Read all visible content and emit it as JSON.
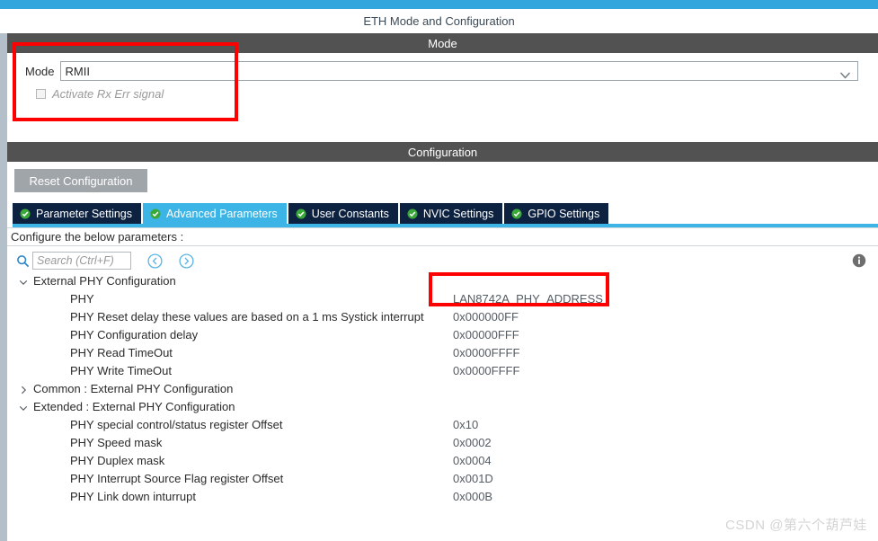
{
  "window": {
    "title": "ETH Mode and Configuration"
  },
  "colors": {
    "accent_top": "#33a6dd",
    "section_header_bg": "#525252",
    "tab_inactive_bg": "#0d2240",
    "tab_active_bg": "#3cb4e5",
    "highlight_box": "#fe0000",
    "reset_button_bg": "#a0a5aa",
    "tick_icon": "#3aa93a"
  },
  "mode_section": {
    "header": "Mode",
    "mode_label": "Mode",
    "mode_value": "RMII",
    "dropdown_icon": "chevron-down-icon",
    "checkbox": {
      "label": "Activate Rx Err signal",
      "checked": false,
      "enabled": false
    }
  },
  "configuration_section": {
    "header": "Configuration",
    "reset_button_label": "Reset Configuration",
    "tabs": [
      {
        "label": "Parameter Settings",
        "icon": "check-circle-icon",
        "active": false
      },
      {
        "label": "Advanced Parameters",
        "icon": "check-circle-icon",
        "active": true
      },
      {
        "label": "User Constants",
        "icon": "check-circle-icon",
        "active": false
      },
      {
        "label": "NVIC Settings",
        "icon": "check-circle-icon",
        "active": false
      },
      {
        "label": "GPIO Settings",
        "icon": "check-circle-icon",
        "active": false
      }
    ],
    "notice": "Configure the below parameters :",
    "search": {
      "icon": "search-icon",
      "placeholder": "Search (Ctrl+F)",
      "value": "",
      "prev_icon": "chevron-left-circle-icon",
      "next_icon": "chevron-right-circle-icon"
    },
    "info_icon": "info-icon",
    "tree": [
      {
        "kind": "group",
        "expanded": true,
        "label": "External PHY Configuration"
      },
      {
        "kind": "leaf",
        "label": "PHY",
        "value": "LAN8742A_PHY_ADDRESS",
        "highlighted": true
      },
      {
        "kind": "leaf",
        "label": "PHY Reset delay these values are based on a 1 ms Systick interrupt",
        "value": "0x000000FF",
        "highlighted": false
      },
      {
        "kind": "leaf",
        "label": "PHY Configuration delay",
        "value": "0x00000FFF",
        "highlighted": false
      },
      {
        "kind": "leaf",
        "label": "PHY Read TimeOut",
        "value": "0x0000FFFF",
        "highlighted": false
      },
      {
        "kind": "leaf",
        "label": "PHY Write TimeOut",
        "value": "0x0000FFFF",
        "highlighted": false
      },
      {
        "kind": "group",
        "expanded": false,
        "label": "Common : External PHY Configuration"
      },
      {
        "kind": "group",
        "expanded": true,
        "label": "Extended : External PHY Configuration"
      },
      {
        "kind": "leaf",
        "label": "PHY special control/status register Offset",
        "value": "0x10",
        "highlighted": false
      },
      {
        "kind": "leaf",
        "label": "PHY Speed mask",
        "value": "0x0002",
        "highlighted": false
      },
      {
        "kind": "leaf",
        "label": "PHY Duplex mask",
        "value": "0x0004",
        "highlighted": false
      },
      {
        "kind": "leaf",
        "label": "PHY Interrupt Source Flag register Offset",
        "value": "0x001D",
        "highlighted": false
      },
      {
        "kind": "leaf",
        "label": "PHY Link down inturrupt",
        "value": "0x000B",
        "highlighted": false
      }
    ]
  },
  "watermark": "CSDN @第六个葫芦娃"
}
